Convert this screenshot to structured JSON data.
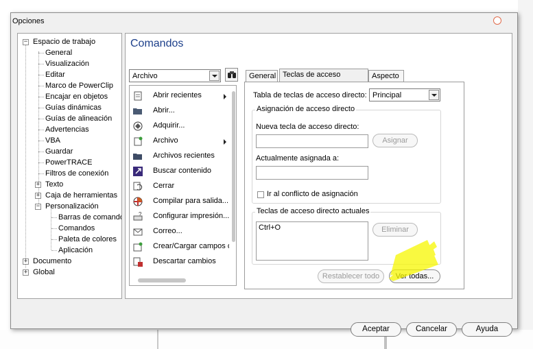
{
  "window": {
    "title": "Opciones"
  },
  "tree": {
    "items": [
      {
        "label": "Espacio de trabajo",
        "expander": "−"
      },
      {
        "label": "General"
      },
      {
        "label": "Visualización"
      },
      {
        "label": "Editar"
      },
      {
        "label": "Marco de PowerClip"
      },
      {
        "label": "Encajar en objetos"
      },
      {
        "label": "Guías dinámicas"
      },
      {
        "label": "Guías de alineación"
      },
      {
        "label": "Advertencias"
      },
      {
        "label": "VBA"
      },
      {
        "label": "Guardar"
      },
      {
        "label": "PowerTRACE"
      },
      {
        "label": "Filtros de conexión"
      },
      {
        "label": "Texto",
        "expander": "+"
      },
      {
        "label": "Caja de herramientas",
        "expander": "+"
      },
      {
        "label": "Personalización",
        "expander": "−"
      },
      {
        "label": "Barras de comandos"
      },
      {
        "label": "Comandos"
      },
      {
        "label": "Paleta de colores"
      },
      {
        "label": "Aplicación"
      },
      {
        "label": "Documento",
        "expander": "+"
      },
      {
        "label": "Global",
        "expander": "+"
      }
    ]
  },
  "main": {
    "title": "Comandos",
    "category_combo": {
      "value": "Archivo"
    },
    "commands": [
      {
        "label": "Abrir recientes",
        "icon": "open-recent-icon",
        "submenu": true
      },
      {
        "label": "Abrir...",
        "icon": "folder-open-icon",
        "submenu": false
      },
      {
        "label": "Adquirir...",
        "icon": "acquire-icon",
        "submenu": false
      },
      {
        "label": "Archivo",
        "icon": "file-icon",
        "submenu": true
      },
      {
        "label": "Archivos recientes",
        "icon": "folder-icon",
        "submenu": false
      },
      {
        "label": "Buscar contenido",
        "icon": "search-content-icon",
        "submenu": false
      },
      {
        "label": "Cerrar",
        "icon": "close-doc-icon",
        "submenu": false
      },
      {
        "label": "Compilar para salida...",
        "icon": "compile-icon",
        "submenu": false
      },
      {
        "label": "Configurar impresión...",
        "icon": "print-setup-icon",
        "submenu": false
      },
      {
        "label": "Correo...",
        "icon": "mail-icon",
        "submenu": false
      },
      {
        "label": "Crear/Cargar campos de",
        "icon": "fields-icon",
        "submenu": false
      },
      {
        "label": "Descartar cambios",
        "icon": "discard-icon",
        "submenu": false
      }
    ],
    "tabs": [
      {
        "label": "General"
      },
      {
        "label": "Teclas de acceso directo"
      },
      {
        "label": "Aspecto"
      }
    ],
    "shortcuts": {
      "table_label": "Tabla de teclas de acceso directo:",
      "table_value": "Principal",
      "assign_group_title": "Asignación de acceso directo",
      "new_key_label": "Nueva tecla de acceso directo:",
      "new_key_value": "",
      "assign_button": "Asignar",
      "current_assigned_label": "Actualmente asignada a:",
      "current_assigned_value": "",
      "goto_conflict_label": "Ir al conflicto de asignación",
      "current_group_title": "Teclas de acceso directo actuales",
      "current_keys": "Ctrl+O",
      "delete_button": "Eliminar",
      "reset_all_button": "Restablecer todo",
      "view_all_button": "Ver todas..."
    }
  },
  "footer": {
    "accept": "Aceptar",
    "cancel": "Cancelar",
    "help": "Ayuda"
  },
  "colors": {
    "title_accent": "#1c3f8a",
    "highlight": "#f7f700",
    "close_button": "#e06a4a"
  }
}
